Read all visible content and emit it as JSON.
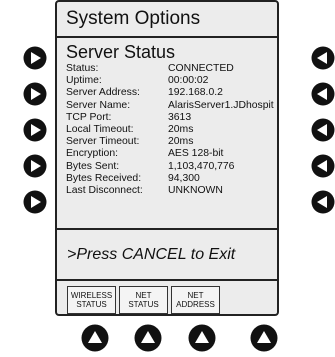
{
  "screen": {
    "title": "System Options",
    "section_title": "Server Status",
    "rows": [
      {
        "label": "Status:",
        "value": "CONNECTED"
      },
      {
        "label": "Uptime:",
        "value": "00:00:02"
      },
      {
        "label": "Server Address:",
        "value": "192.168.0.2"
      },
      {
        "label": "Server Name:",
        "value": "AlarisServer1.JDhospit"
      },
      {
        "label": "TCP Port:",
        "value": "3613"
      },
      {
        "label": "Local Timeout:",
        "value": "20ms"
      },
      {
        "label": "Server Timeout:",
        "value": "20ms"
      },
      {
        "label": "Encryption:",
        "value": "AES 128-bit"
      },
      {
        "label": "Bytes Sent:",
        "value": "1,103,470,776"
      },
      {
        "label": "Bytes Received:",
        "value": "94,300"
      },
      {
        "label": "Last Disconnect:",
        "value": "UNKNOWN"
      }
    ],
    "cancel_prompt": ">Press CANCEL to Exit"
  },
  "softkeys": [
    {
      "line1": "WIRELESS",
      "line2": "STATUS"
    },
    {
      "line1": "NET",
      "line2": "STATUS"
    },
    {
      "line1": "NET",
      "line2": "ADDRESS"
    }
  ],
  "icons": {
    "left_buttons": "play-right-icon",
    "right_buttons": "play-left-icon",
    "bottom_buttons": "play-up-icon"
  },
  "colors": {
    "screen_bg": "#ececec",
    "button_fill": "#111111",
    "button_glyph": "#ffffff"
  }
}
